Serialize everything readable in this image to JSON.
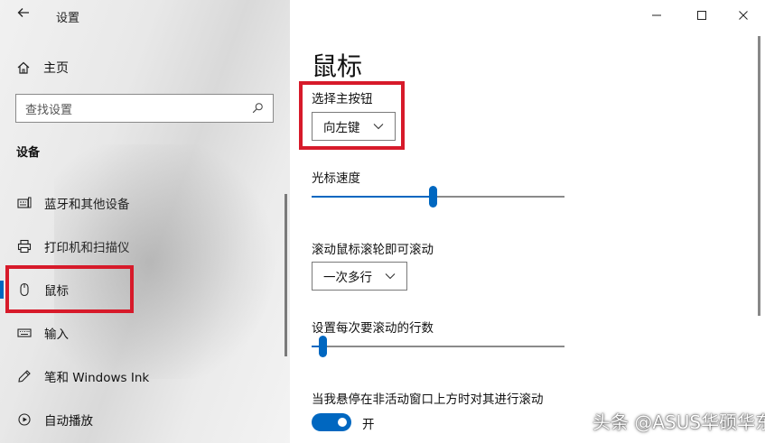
{
  "window": {
    "title": "设置",
    "controls": [
      "minimize-icon",
      "maximize-icon",
      "close-icon"
    ]
  },
  "sidebar": {
    "home_label": "主页",
    "search_placeholder": "查找设置",
    "section_title": "设备",
    "items": [
      {
        "label": "蓝牙和其他设备",
        "icon": "bluetooth-devices-icon",
        "active": false
      },
      {
        "label": "打印机和扫描仪",
        "icon": "printer-icon",
        "active": false
      },
      {
        "label": "鼠标",
        "icon": "mouse-icon",
        "active": true
      },
      {
        "label": "输入",
        "icon": "keyboard-icon",
        "active": false
      },
      {
        "label": "笔和 Windows Ink",
        "icon": "pen-icon",
        "active": false
      },
      {
        "label": "自动播放",
        "icon": "autoplay-icon",
        "active": false
      }
    ]
  },
  "main": {
    "title": "鼠标",
    "primary_button": {
      "label": "选择主按钮",
      "value": "向左键"
    },
    "cursor_speed": {
      "label": "光标速度",
      "level": 0.48
    },
    "scroll_wheel": {
      "label": "滚动鼠标滚轮即可滚动",
      "value": "一次多行"
    },
    "lines_per_scroll": {
      "label": "设置每次要滚动的行数",
      "level": 0.03
    },
    "inactive_scroll": {
      "label": "当我悬停在非活动窗口上方时对其进行滚动",
      "state": "开",
      "on": true
    }
  },
  "watermark": "头条 @ASUS华硕华东",
  "colors": {
    "accent": "#0067c0",
    "highlight_box": "#d71a2a"
  }
}
